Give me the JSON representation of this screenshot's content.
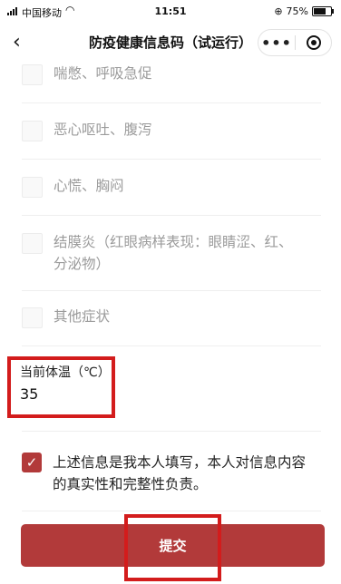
{
  "status_bar": {
    "carrier": "中国移动",
    "time": "11:51",
    "battery": "75%"
  },
  "nav": {
    "title": "防疫健康信息码（试运行）",
    "more_icon": "•••"
  },
  "symptoms": [
    {
      "label": "喘憋、呼吸急促",
      "checked": false
    },
    {
      "label": "恶心呕吐、腹泻",
      "checked": false
    },
    {
      "label": "心慌、胸闷",
      "checked": false
    },
    {
      "label": "结膜炎（红眼病样表现：眼睛涩、红、分泌物）",
      "checked": false
    },
    {
      "label": "其他症状",
      "checked": false
    }
  ],
  "temperature": {
    "label": "当前体温（℃）",
    "value": "35"
  },
  "agreement": {
    "text": "上述信息是我本人填写，本人对信息内容的真实性和完整性负责。",
    "checked": true
  },
  "submit": {
    "label": "提交"
  },
  "colors": {
    "accent": "#b23a3a",
    "highlight": "#d31c1c"
  }
}
